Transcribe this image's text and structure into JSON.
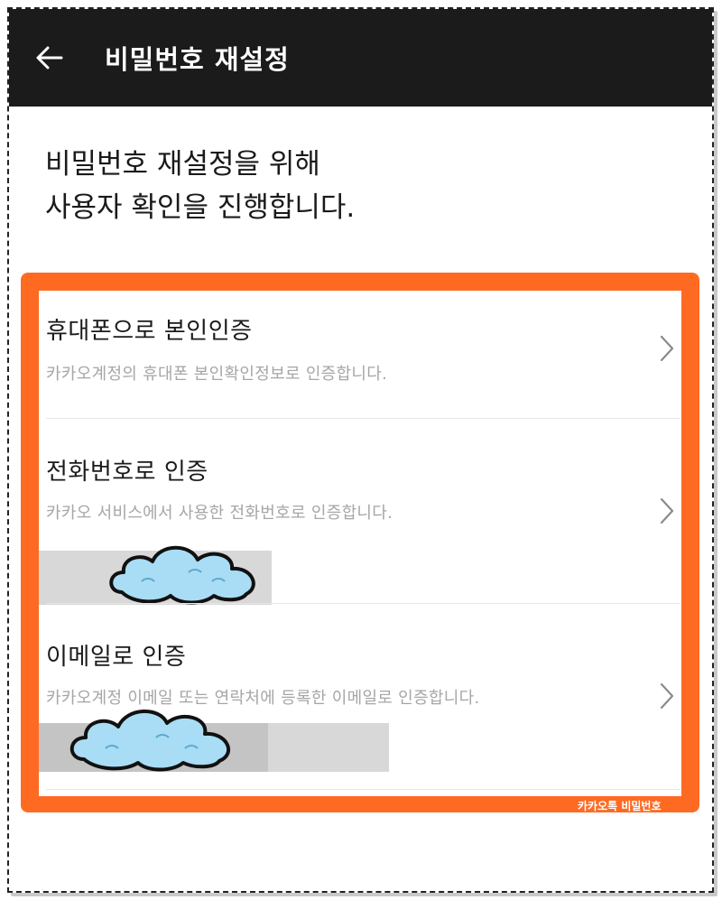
{
  "header": {
    "title": "비밀번호 재설정",
    "back_icon": "arrow-left-icon"
  },
  "intro": {
    "line1": "비밀번호 재설정을 위해",
    "line2": "사용자 확인을 진행합니다."
  },
  "options": [
    {
      "title": "휴대폰으로 본인인증",
      "description": "카카오계정의 휴대폰 본인확인정보로 인증합니다."
    },
    {
      "title": "전화번호로 인증",
      "description": "카카오 서비스에서 사용한 전화번호로 인증합니다."
    },
    {
      "title": "이메일로 인증",
      "description": "카카오계정 이메일 또는 연락처에 등록한 이메일로 인증합니다."
    }
  ],
  "watermark": "카카오톡 비밀번호",
  "colors": {
    "header_bg": "#1b1b1b",
    "highlight_border": "#ff6a22",
    "description_text": "#a6a6a6"
  }
}
